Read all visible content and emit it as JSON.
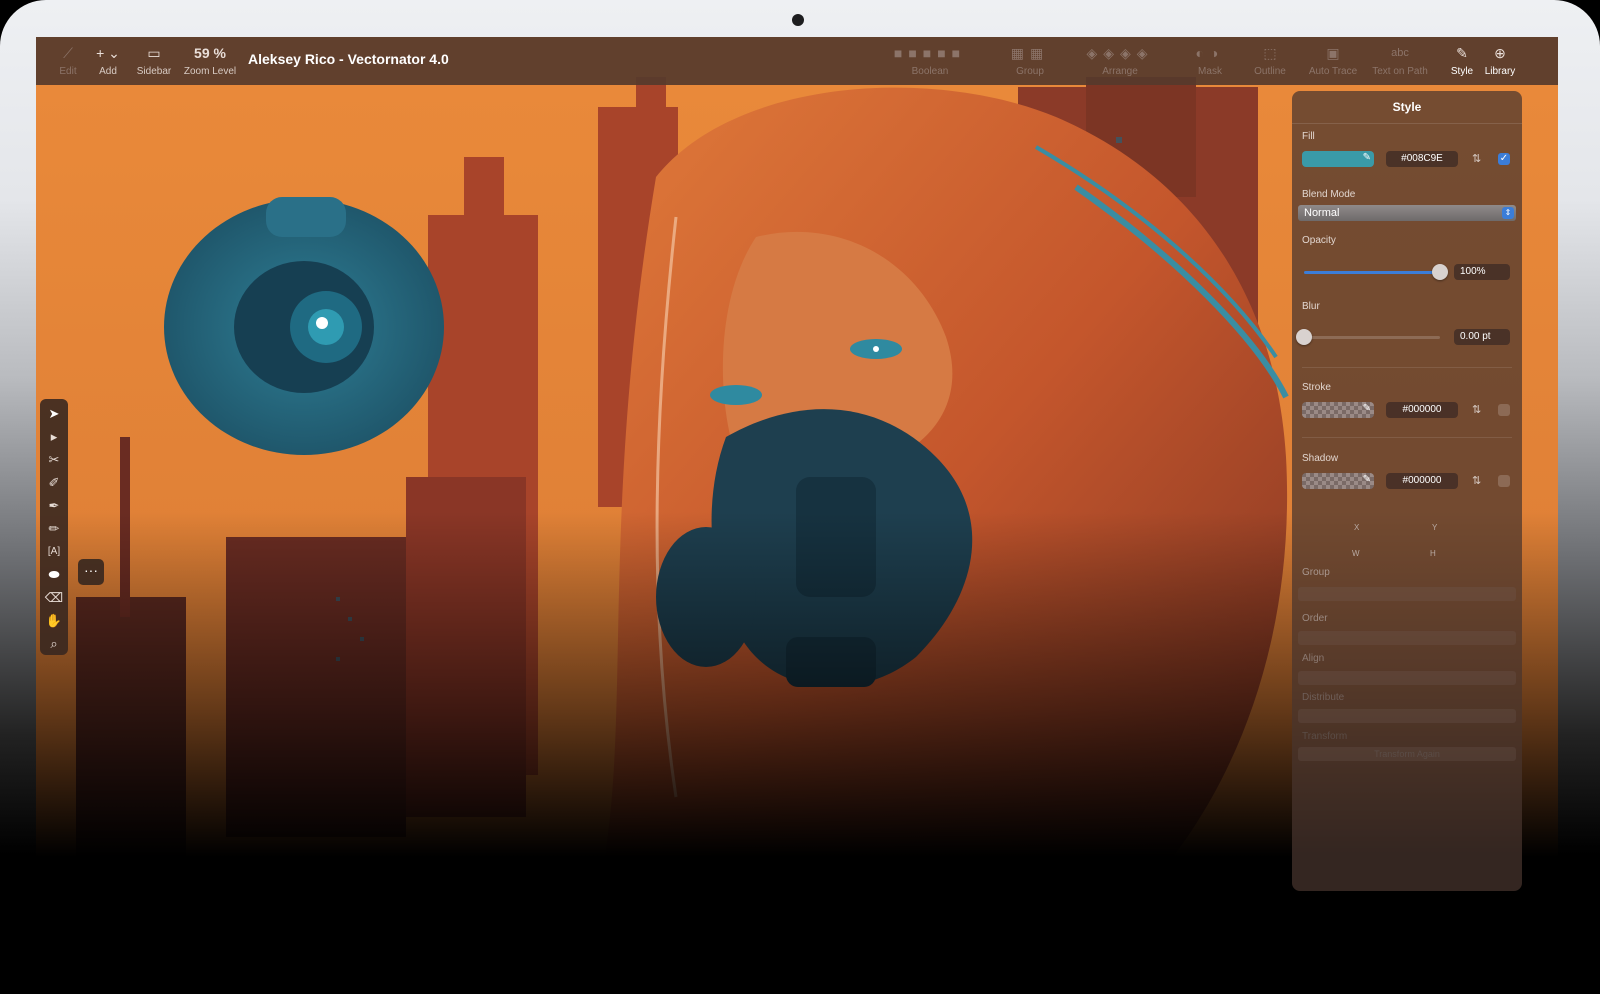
{
  "window": {
    "title": "Aleksey Rico - Vectornator 4.0"
  },
  "toolbar": {
    "left": [
      {
        "label": "Edit",
        "icon": "pen-nib-icon",
        "enabled": false
      },
      {
        "label": "Add",
        "icon": "plus-icon"
      },
      {
        "label": "Sidebar",
        "icon": "sidebar-icon"
      },
      {
        "label": "Zoom Level",
        "value": "59 %"
      }
    ],
    "right": [
      {
        "label": "Boolean",
        "icon": "boolean-icon",
        "enabled": false
      },
      {
        "label": "Group",
        "icon": "group-icon",
        "enabled": false
      },
      {
        "label": "Arrange",
        "icon": "arrange-icon",
        "enabled": false
      },
      {
        "label": "Mask",
        "icon": "mask-icon",
        "enabled": false
      },
      {
        "label": "Outline",
        "icon": "outline-icon",
        "enabled": false
      },
      {
        "label": "Auto Trace",
        "icon": "auto-trace-icon",
        "enabled": false
      },
      {
        "label": "Text on Path",
        "icon": "text-on-path-icon",
        "glyph": "abc",
        "enabled": false
      },
      {
        "label": "Style",
        "icon": "brush-icon",
        "active": true
      },
      {
        "label": "Library",
        "icon": "library-icon"
      }
    ]
  },
  "tools": [
    "selection-tool",
    "direct-selection-tool",
    "scissors-tool",
    "brush-tool",
    "pen-tool",
    "pencil-tool",
    "text-tool",
    "shape-tool",
    "eraser-tool",
    "hand-tool",
    "zoom-tool"
  ],
  "more_button": "···",
  "style_panel": {
    "title": "Style",
    "fill": {
      "label": "Fill",
      "hex": "#008C9E",
      "enabled": true,
      "color": "#3a9aa8"
    },
    "blend_mode": {
      "label": "Blend Mode",
      "value": "Normal"
    },
    "opacity": {
      "label": "Opacity",
      "value": "100%",
      "level": 1.0
    },
    "blur": {
      "label": "Blur",
      "value": "0.00 pt",
      "level": 0.0
    },
    "stroke": {
      "label": "Stroke",
      "hex": "#000000",
      "enabled": false
    },
    "shadow": {
      "label": "Shadow",
      "hex": "#000000",
      "enabled": false
    },
    "geometry": {
      "x_label": "X",
      "y_label": "Y",
      "w_label": "W",
      "h_label": "H"
    },
    "group": {
      "label": "Group"
    },
    "order": {
      "label": "Order"
    },
    "align": {
      "label": "Align"
    },
    "distribute": {
      "label": "Distribute"
    },
    "transform": {
      "label": "Transform",
      "apply_button": "Transform Again"
    }
  }
}
